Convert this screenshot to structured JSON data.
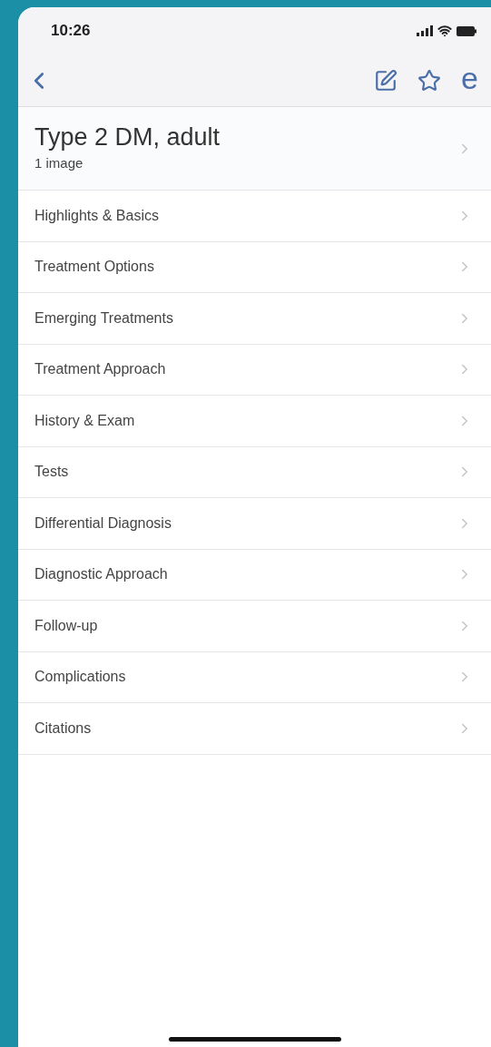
{
  "status_bar": {
    "time": "10:26"
  },
  "nav_bar": {
    "logo_letter": "e"
  },
  "header": {
    "title": "Type 2 DM, adult",
    "subtitle": "1 image"
  },
  "sections": [
    {
      "label": "Highlights & Basics"
    },
    {
      "label": "Treatment Options"
    },
    {
      "label": "Emerging Treatments"
    },
    {
      "label": "Treatment Approach"
    },
    {
      "label": "History & Exam"
    },
    {
      "label": "Tests"
    },
    {
      "label": "Differential Diagnosis"
    },
    {
      "label": "Diagnostic Approach"
    },
    {
      "label": "Follow-up"
    },
    {
      "label": "Complications"
    },
    {
      "label": "Citations"
    }
  ]
}
